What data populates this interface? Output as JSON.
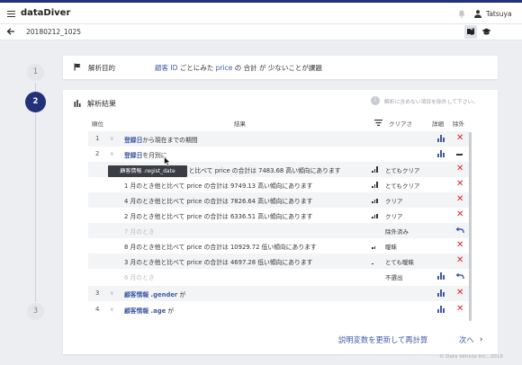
{
  "app": {
    "brand": "dataDiver",
    "user": "Tatsuya"
  },
  "subbar": {
    "breadcrumb": "20180212_1025"
  },
  "steps": [
    "1",
    "2",
    "3"
  ],
  "purpose": {
    "label": "解析目的",
    "keyword1": "顧客 ID",
    "text1": " ごとにみた ",
    "keyword2": "price",
    "text2": " の 合計 が 少ないことが課題"
  },
  "results": {
    "title": "解析結果",
    "hint": "解析に含めない項目を除外して下さい。",
    "columns": {
      "rank": "順位",
      "result": "結果",
      "clarity": "クリアさ",
      "detail": "詳細",
      "exclude": "除外"
    },
    "rows": [
      {
        "rank": "1",
        "chev": "∨",
        "kw": "登録日",
        "text": "から現在までの期間"
      },
      {
        "rank": "2",
        "chev": "∧",
        "kw": "登録日",
        "text": "を月別に"
      },
      {
        "text": "顧客情報 .regist_date と比べて price の合計は 7483.68 高い傾向にあります",
        "clarity": "とてもクリア"
      },
      {
        "text": "1 月のとき他と比べて price の合計は 9749.13 高い傾向にあります",
        "clarity": "とてもクリア"
      },
      {
        "text": "4 月のとき他と比べて price の合計は 7826.64 高い傾向にあります",
        "clarity": "クリア"
      },
      {
        "text": "2 月のとき他と比べて price の合計は 6336.51 高い傾向にあります",
        "clarity": "クリア"
      },
      {
        "text": "7 月のとき",
        "clarity": "除外済み"
      },
      {
        "text": "8 月のとき他と比べて price の合計は 10929.72 低い傾向にあります",
        "clarity": "曖昧"
      },
      {
        "text": "3 月のとき他と比べて price の合計は 4697.28 低い傾向にあります",
        "clarity": "とても曖昧"
      },
      {
        "text": "6 月のとき",
        "clarity": "不選出"
      },
      {
        "rank": "3",
        "chev": "∨",
        "kw": "顧客情報 .gender",
        "text": " が"
      },
      {
        "rank": "4",
        "chev": "∨",
        "kw": "顧客情報 .age",
        "text": " が"
      }
    ],
    "r3_pre": "",
    "r3_mid": " 月のとき他と比べて ",
    "price": "price",
    "tooltip": "顧客情報 .regist_date",
    "update_button": "説明変数を更新して再計算",
    "next_button": "次へ",
    "next_arrow": "›"
  },
  "footer": "© Data Vehicle Inc., 2018",
  "colors": {
    "brand_navy": "#23307a",
    "link_blue": "#3d5aa3",
    "danger_red": "#e02020"
  },
  "icons": [
    "hamburger-icon",
    "bell-icon",
    "user-icon",
    "back-arrow-icon",
    "guide-icon",
    "graduation-cap-icon",
    "flag-icon",
    "bar-chart-icon",
    "info-icon",
    "filter-icon",
    "detail-chart-icon",
    "close-icon",
    "undo-icon",
    "minus-icon",
    "signal-icon"
  ]
}
